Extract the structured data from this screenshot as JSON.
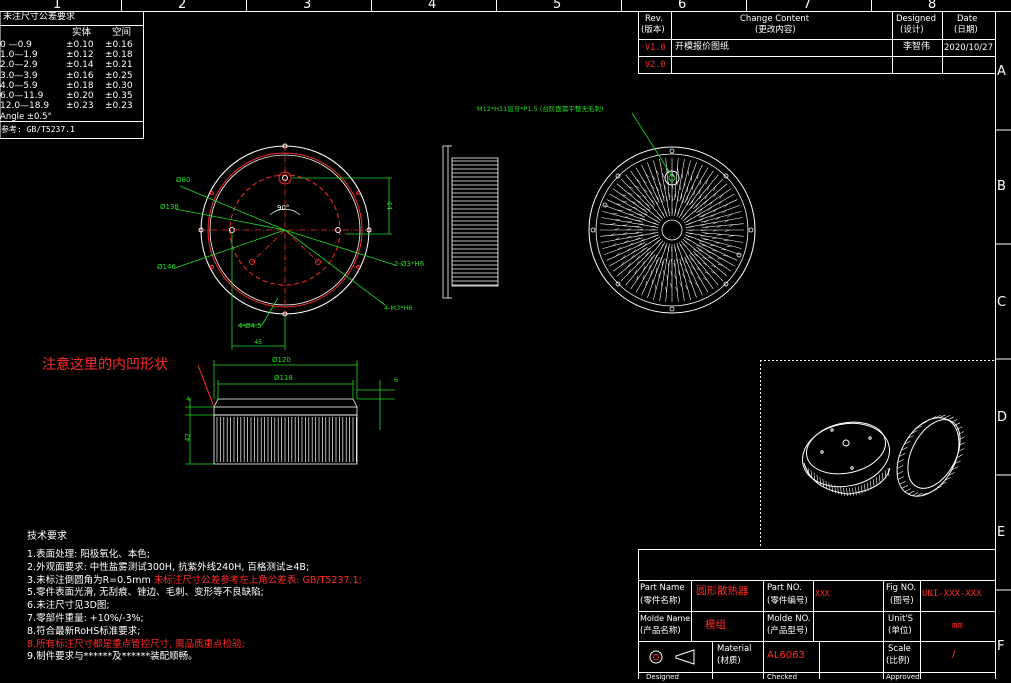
{
  "ruler": {
    "top_numbers": [
      "1",
      "2",
      "3",
      "4",
      "5",
      "6",
      "7",
      "8"
    ],
    "side_letters": [
      "A",
      "B",
      "C",
      "D",
      "E",
      "F"
    ]
  },
  "tolerance_table": {
    "title": "未注尺寸公差要求",
    "col_solid": "实体",
    "col_space": "空间",
    "rows": [
      {
        "range": "0 —0.9",
        "solid": "±0.10",
        "space": "±0.16"
      },
      {
        "range": "1.0—1.9",
        "solid": "±0.12",
        "space": "±0.18"
      },
      {
        "range": "2.0—2.9",
        "solid": "±0.14",
        "space": "±0.21"
      },
      {
        "range": "3.0—3.9",
        "solid": "±0.16",
        "space": "±0.25"
      },
      {
        "range": "4.0—5.9",
        "solid": "±0.18",
        "space": "±0.30"
      },
      {
        "range": "6.0—11.9",
        "solid": "±0.20",
        "space": "±0.35"
      },
      {
        "range": "12.0—18.9",
        "solid": "±0.23",
        "space": "±0.23"
      }
    ],
    "angle": "Angle ±0.5°",
    "reference": "参考: GB/T5237.1"
  },
  "revision_table": {
    "rev_label": "Rev.",
    "rev_label_cn": "(版本)",
    "change_label": "Change Content",
    "change_label_cn": "(更改内容)",
    "designed_label": "Designed",
    "designed_label_cn": "(设计)",
    "date_label": "Date",
    "date_label_cn": "(日期)",
    "rows": [
      {
        "rev": "V1.0",
        "content": "开模报价图纸",
        "designer": "李智伟",
        "date": "2020/10/27"
      },
      {
        "rev": "V2.0",
        "content": "",
        "designer": "",
        "date": ""
      }
    ]
  },
  "dimensions": {
    "d80": "Ø80",
    "d138": "Ø138",
    "d146": "Ø146",
    "angle90": "90°",
    "h44": "44",
    "holes_2": "2-Ø3*H6",
    "holes_4a": "4-Ø4.5",
    "holes_4b": "4-M3*H6",
    "w45": "45",
    "d120": "Ø120",
    "d118": "Ø118",
    "t4": "4",
    "t6": "6",
    "h42": "42",
    "thread_note": "M12*H11盲牙*P1.5 (台阶面需平整无毛刺)"
  },
  "annotation_note": "注意这里的内凹形状",
  "tech_requirements": {
    "title": "技术要求",
    "items": [
      {
        "text": "1.表面处理: 阳极氧化、本色;",
        "red": ""
      },
      {
        "text": "2.外观面要求: 中性盐雾测试300H, 抗紫外线240H, 百格测试≥4B;",
        "red": ""
      },
      {
        "text": "3.未标注倒圆角为R=0.5mm ",
        "red": "未标注尺寸公差参考左上角公差表: GB/T5237.1;"
      },
      {
        "text": "5.零件表面光滑, 无刮痕、锉边、毛刺、变形等不良缺陷;",
        "red": ""
      },
      {
        "text": "6.未注尺寸见3D图;",
        "red": ""
      },
      {
        "text": "7.零部件重量: +10%/-3%;",
        "red": ""
      },
      {
        "text": "8.符合最新RoHS标准要求;",
        "red": ""
      },
      {
        "text": "",
        "red": "8.所有标注尺寸都是重点管控尺寸, 需品质重点检验;"
      },
      {
        "text": "9.制件要求与******及******装配顺畅。",
        "red": ""
      }
    ]
  },
  "title_block": {
    "part_name_label": "Part Name",
    "part_name_label_cn": "(零件名称)",
    "part_name_value": "圆形散热器",
    "part_no_label": "Part NO.",
    "part_no_label_cn": "(零件编号)",
    "part_no_value": "XXX",
    "fig_no_label": "Fig NO.",
    "fig_no_label_cn": "(图号)",
    "fig_no_value": "UNI-XXX-XXX",
    "molde_name_label": "Molde Name",
    "molde_name_label_cn": "(产品名称)",
    "molde_name_value": "模组",
    "molde_no_label": "Molde NO.",
    "molde_no_label_cn": "(产品型号)",
    "units_label": "Unit'S",
    "units_label_cn": "(单位)",
    "units_value": "mm",
    "material_label": "Material",
    "material_label_cn": "(材质)",
    "material_value": "AL6063",
    "scale_label": "Scale",
    "scale_label_cn": "(比例)",
    "scale_value": "/",
    "designed_label": "Designed",
    "checked_label": "Checked",
    "approved_label": "Approved"
  }
}
